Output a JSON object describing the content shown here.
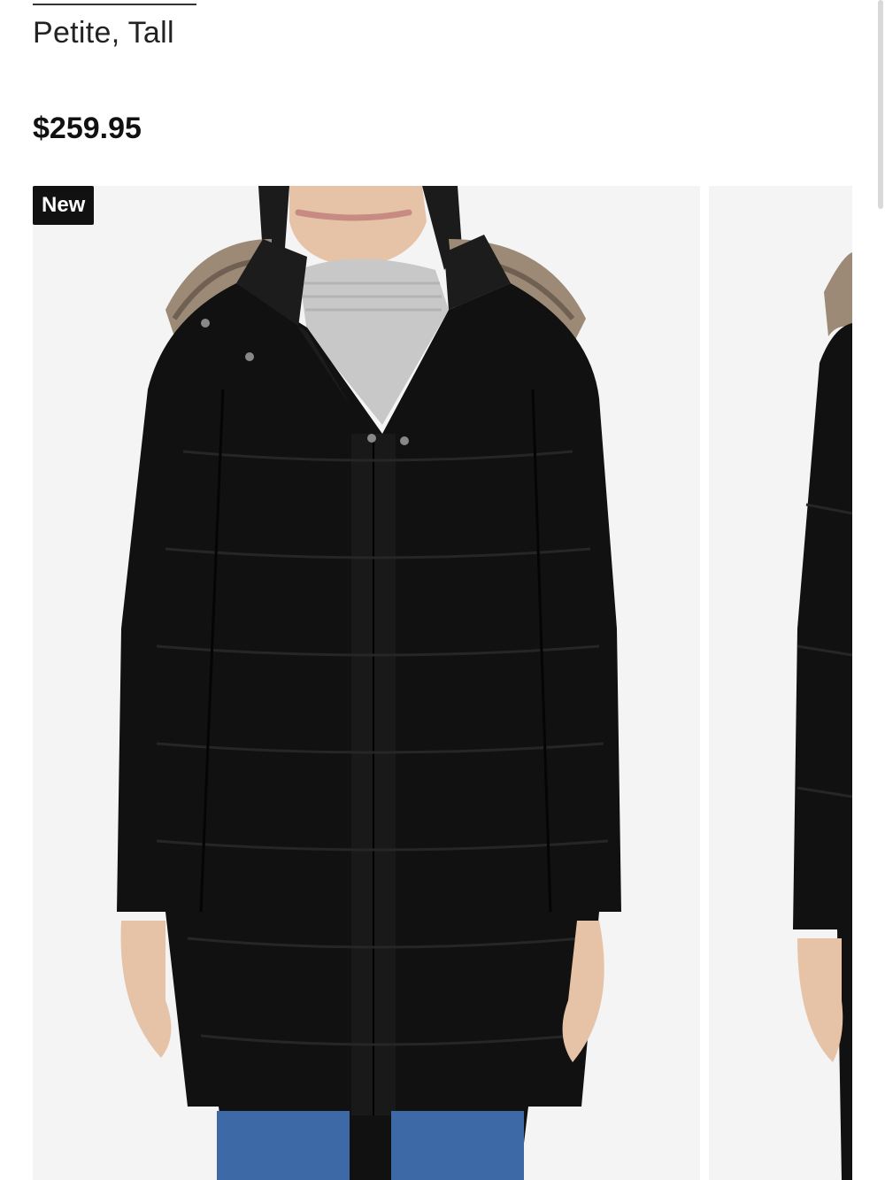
{
  "product": {
    "size_options": "Petite, Tall",
    "price": "$259.95"
  },
  "gallery": {
    "badge": "New",
    "images": [
      {
        "icon": "product-photo-front"
      },
      {
        "icon": "product-photo-side"
      }
    ]
  },
  "colors": {
    "coat": "#111111",
    "background": "#f4f4f4",
    "sweater": "#c8c8c8",
    "fur": "#9c8a76",
    "jeans": "#3d6aa6",
    "skin": "#e6c3a6"
  }
}
